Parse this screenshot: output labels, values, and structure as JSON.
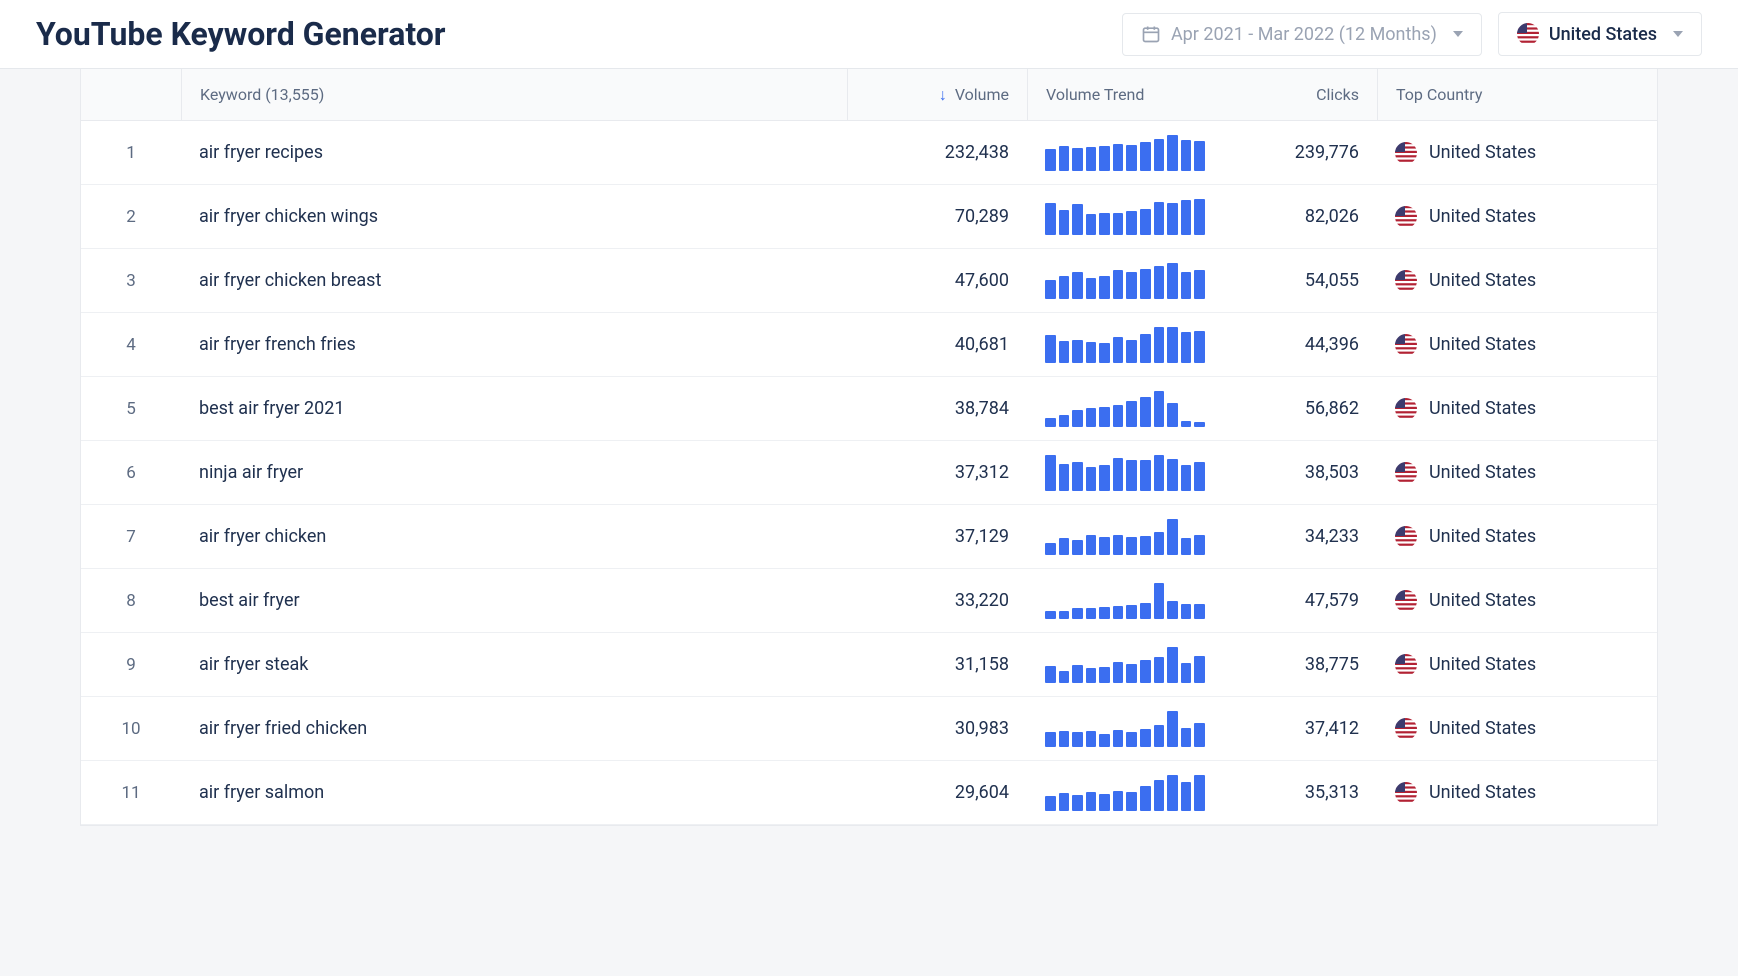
{
  "header": {
    "title": "YouTube Keyword Generator",
    "date_range": "Apr 2021 - Mar 2022 (12 Months)",
    "country": "United States"
  },
  "table": {
    "columns": {
      "keyword": "Keyword (13,555)",
      "volume": "Volume",
      "trend": "Volume Trend",
      "clicks": "Clicks",
      "country": "Top Country"
    },
    "rows": [
      {
        "rank": 1,
        "keyword": "air fryer recipes",
        "volume": "232,438",
        "clicks": "239,776",
        "country": "United States",
        "trend": [
          55,
          62,
          58,
          60,
          62,
          68,
          66,
          74,
          80,
          92,
          78,
          76
        ]
      },
      {
        "rank": 2,
        "keyword": "air fryer chicken wings",
        "volume": "70,289",
        "clicks": "82,026",
        "country": "United States",
        "trend": [
          80,
          62,
          78,
          52,
          56,
          54,
          60,
          64,
          82,
          80,
          88,
          92
        ]
      },
      {
        "rank": 3,
        "keyword": "air fryer chicken breast",
        "volume": "47,600",
        "clicks": "54,055",
        "country": "United States",
        "trend": [
          48,
          58,
          70,
          54,
          58,
          74,
          70,
          76,
          86,
          94,
          70,
          74
        ]
      },
      {
        "rank": 4,
        "keyword": "air fryer french fries",
        "volume": "40,681",
        "clicks": "44,396",
        "country": "United States",
        "trend": [
          70,
          54,
          58,
          52,
          50,
          66,
          58,
          72,
          90,
          92,
          78,
          80
        ]
      },
      {
        "rank": 5,
        "keyword": "best air fryer 2021",
        "volume": "38,784",
        "clicks": "56,862",
        "country": "United States",
        "trend": [
          22,
          30,
          42,
          48,
          52,
          56,
          66,
          78,
          94,
          62,
          14,
          12
        ]
      },
      {
        "rank": 6,
        "keyword": "ninja air fryer",
        "volume": "37,312",
        "clicks": "38,503",
        "country": "United States",
        "trend": [
          92,
          68,
          72,
          60,
          66,
          82,
          78,
          78,
          90,
          80,
          64,
          72
        ]
      },
      {
        "rank": 7,
        "keyword": "air fryer chicken",
        "volume": "37,129",
        "clicks": "34,233",
        "country": "United States",
        "trend": [
          30,
          46,
          40,
          54,
          48,
          54,
          48,
          50,
          60,
          98,
          44,
          54
        ]
      },
      {
        "rank": 8,
        "keyword": "best air fryer",
        "volume": "33,220",
        "clicks": "47,579",
        "country": "United States",
        "trend": [
          18,
          20,
          26,
          28,
          30,
          32,
          34,
          40,
          92,
          44,
          38,
          36
        ]
      },
      {
        "rank": 9,
        "keyword": "air fryer steak",
        "volume": "31,158",
        "clicks": "38,775",
        "country": "United States",
        "trend": [
          42,
          30,
          46,
          36,
          40,
          52,
          48,
          58,
          66,
          92,
          50,
          68
        ]
      },
      {
        "rank": 10,
        "keyword": "air fryer fried chicken",
        "volume": "30,983",
        "clicks": "37,412",
        "country": "United States",
        "trend": [
          38,
          40,
          36,
          40,
          32,
          42,
          36,
          46,
          54,
          92,
          48,
          60
        ]
      },
      {
        "rank": 11,
        "keyword": "air fryer salmon",
        "volume": "29,604",
        "clicks": "35,313",
        "country": "United States",
        "trend": [
          32,
          40,
          36,
          42,
          38,
          44,
          42,
          56,
          70,
          80,
          64,
          82
        ]
      }
    ]
  },
  "icons": {
    "sort_arrow": "↓"
  }
}
